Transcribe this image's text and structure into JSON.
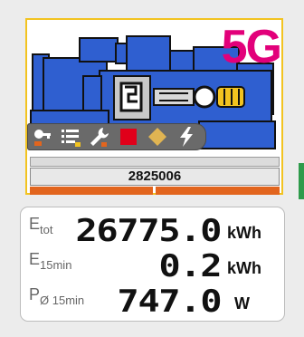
{
  "device": {
    "brand_label": "5G",
    "counter_value": "2825006",
    "accent_color": "#e2007a",
    "frame_color": "#f2c320",
    "machine_color": "#2f5fd0",
    "progress_bar_color": "#e2651e"
  },
  "toolbar_icons": [
    "key-settings-icon",
    "list-icon",
    "wrench-icon",
    "stop-square-icon",
    "diamond-icon",
    "lightning-icon"
  ],
  "energy": {
    "rows": [
      {
        "label_main": "E",
        "label_sub": "tot",
        "value": "26775.0",
        "unit": "kWh"
      },
      {
        "label_main": "E",
        "label_sub": "15min",
        "value": "0.2",
        "unit": "kWh"
      },
      {
        "label_main": "P",
        "label_sub": "Ø 15min",
        "value": "747.0",
        "unit": "W"
      }
    ]
  }
}
